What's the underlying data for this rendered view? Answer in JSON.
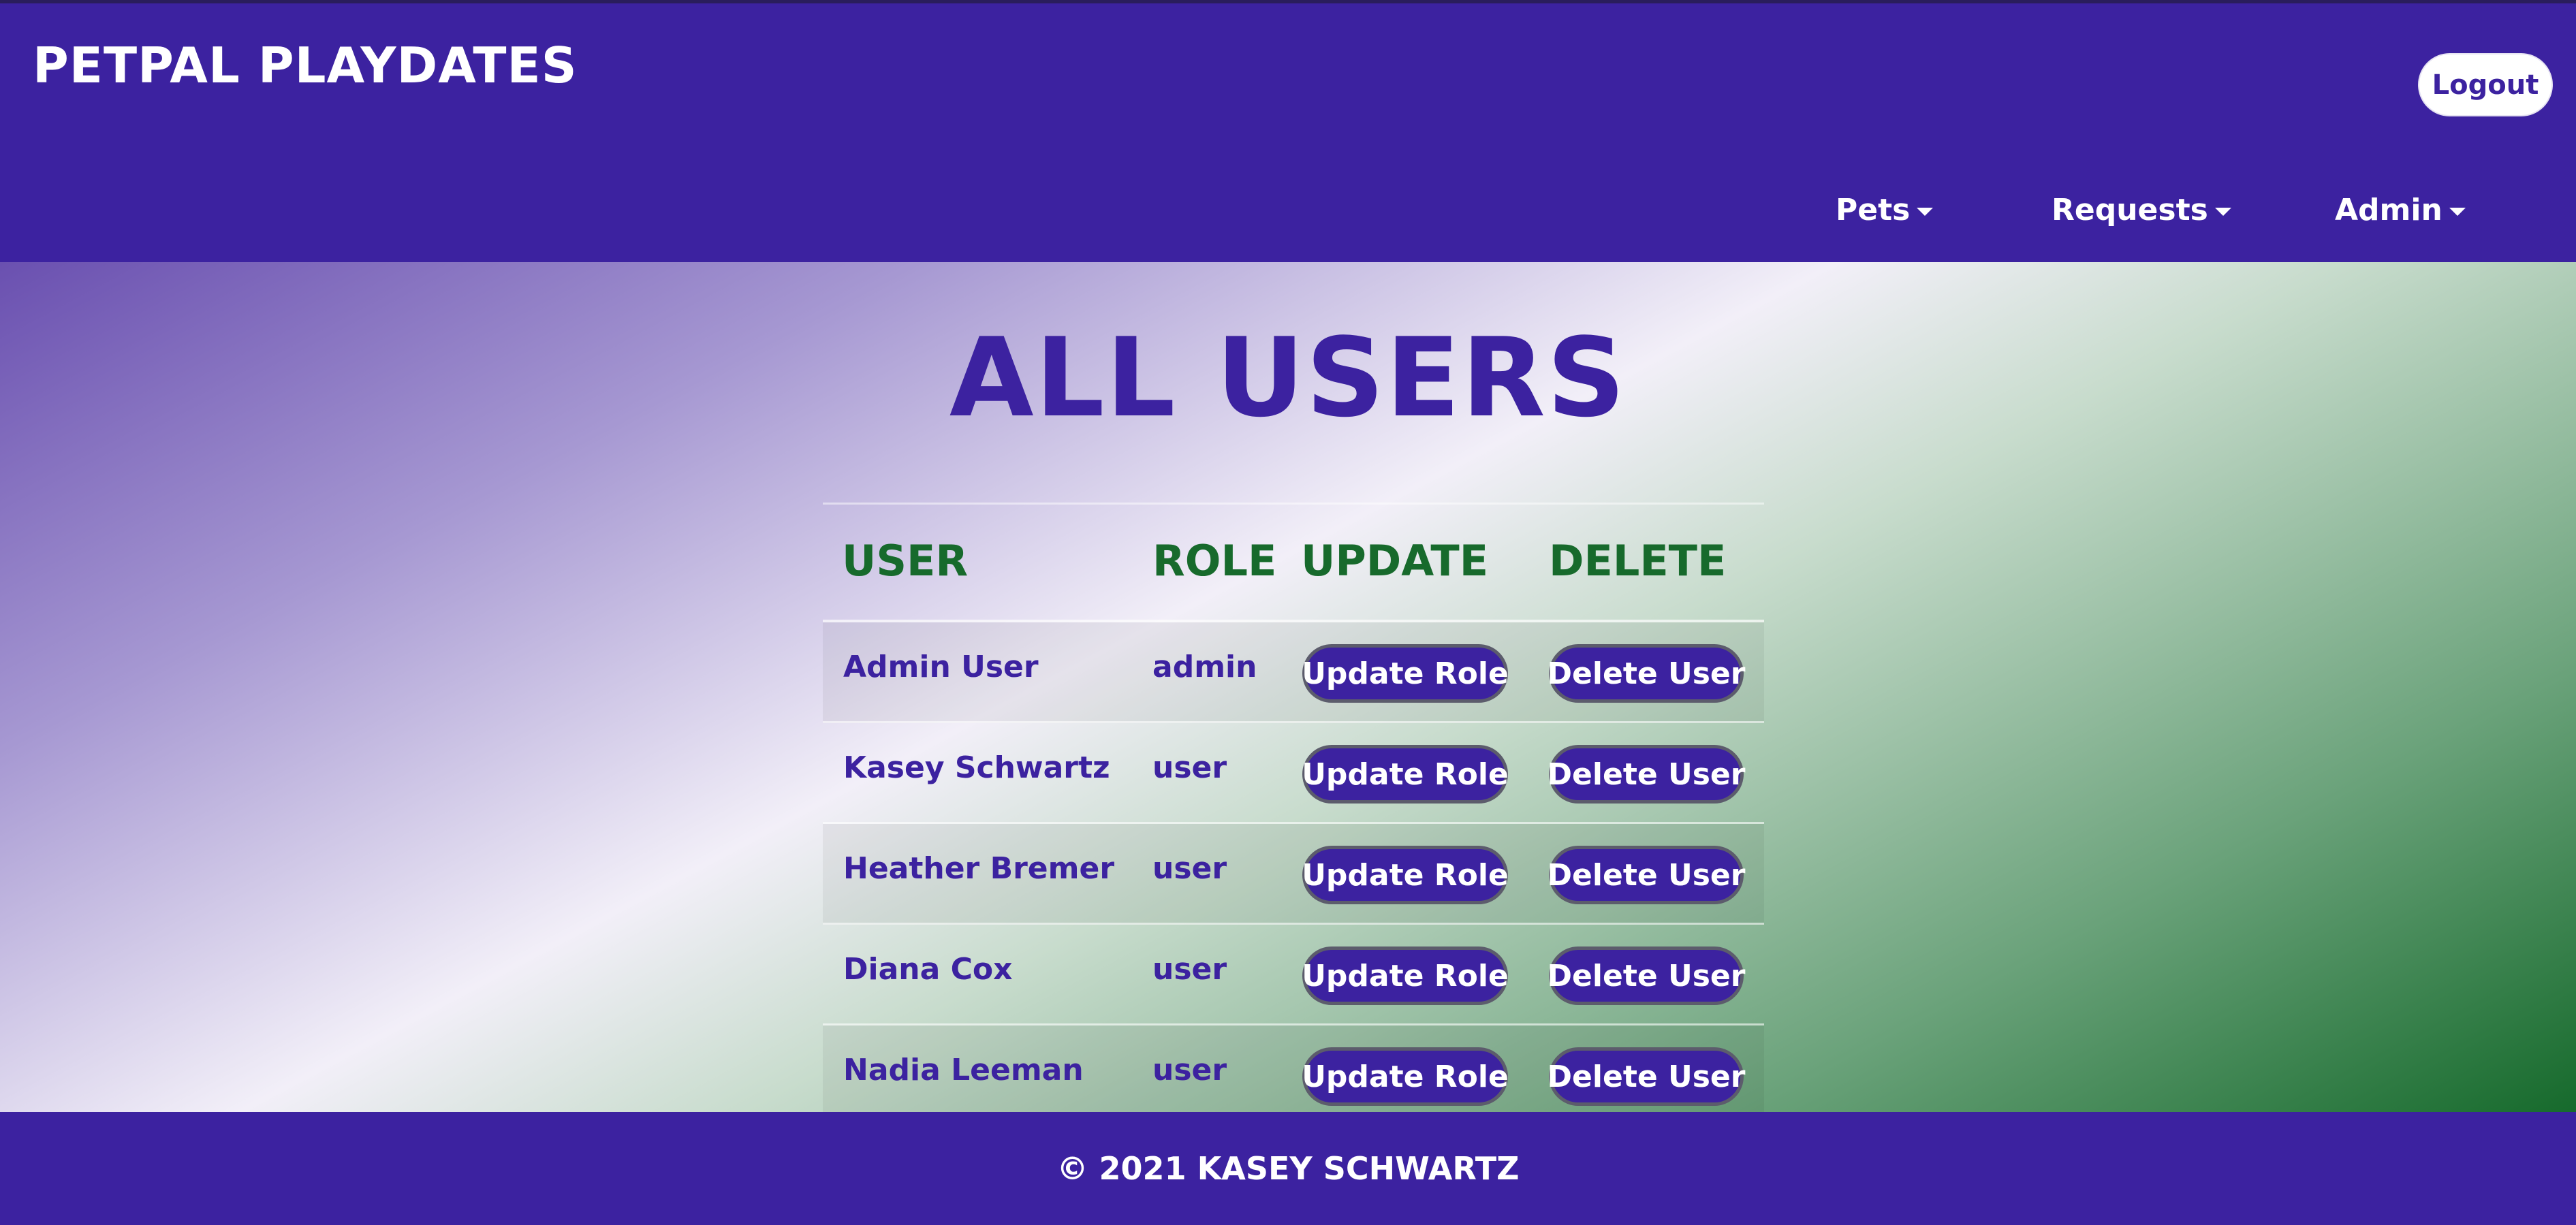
{
  "app": {
    "brand": "PETPAL PLAYDATES",
    "logout_label": "Logout",
    "colors": {
      "primary": "#3c22a0",
      "accent_green": "#176a2c",
      "white": "#ffffff"
    }
  },
  "nav": {
    "items": [
      {
        "label": "Pets",
        "icon": "caret-down-icon"
      },
      {
        "label": "Requests",
        "icon": "caret-down-icon"
      },
      {
        "label": "Admin",
        "icon": "caret-down-icon"
      }
    ]
  },
  "main": {
    "title": "ALL USERS",
    "table": {
      "headers": [
        "USER",
        "ROLE",
        "UPDATE",
        "DELETE"
      ],
      "rows": [
        {
          "name": "Admin User",
          "role": "admin",
          "update_label": "Update Role",
          "delete_label": "Delete User"
        },
        {
          "name": "Kasey Schwartz",
          "role": "user",
          "update_label": "Update Role",
          "delete_label": "Delete User"
        },
        {
          "name": "Heather Bremer",
          "role": "user",
          "update_label": "Update Role",
          "delete_label": "Delete User"
        },
        {
          "name": "Diana Cox",
          "role": "user",
          "update_label": "Update Role",
          "delete_label": "Delete User"
        },
        {
          "name": "Nadia Leeman",
          "role": "user",
          "update_label": "Update Role",
          "delete_label": "Delete User"
        }
      ]
    }
  },
  "footer": {
    "text": "© 2021 KASEY SCHWARTZ"
  }
}
